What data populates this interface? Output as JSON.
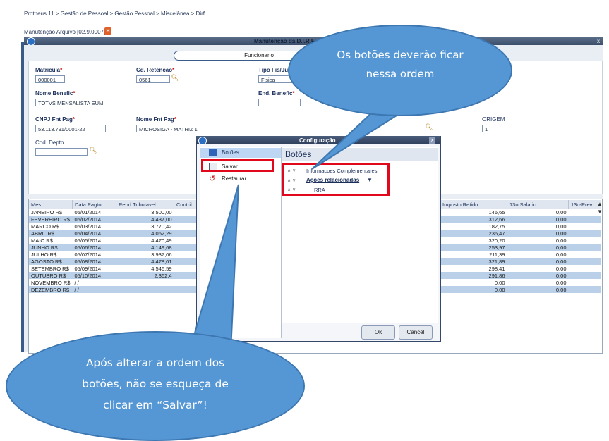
{
  "breadcrumb": "Protheus 11 > Gestão de Pessoal > Gestão Pessoal > Miscelânea > Dirf",
  "subtitle": "Manutenção Arquivo [02.9.0007]",
  "window": {
    "title": "Manutenção da D.I.R.F.",
    "close": "x"
  },
  "tab_label": "Funcionario",
  "form": {
    "matricula_label": "Matricula",
    "matricula_value": "000001",
    "cdret_label": "Cd. Retencao",
    "cdret_value": "0561",
    "tipo_label": "Tipo Fis/Jur",
    "tipo_value": "Fisica",
    "nome_label": "Nome Benefic",
    "nome_value": "TOTVS MENSALISTA EUM",
    "end_label": "End. Benefic",
    "cnpj_label": "CNPJ Fnt Pag",
    "cnpj_value": "53.113.791/0001-22",
    "nomefnt_label": "Nome Fnt Pag",
    "nomefnt_value": "MICROSIGA - MATRIZ 1",
    "origem_label": "ORIGEM",
    "origem_value": "1",
    "depto_label": "Cod. Depto.",
    "required_mark": "*"
  },
  "grid": {
    "headers": [
      "Mes",
      "Data Pagto",
      "Rend.Tributavel",
      "Contrib"
    ],
    "right_headers": [
      "Imposto Retido",
      "13o Salario",
      "13o-Prev."
    ],
    "rows": [
      {
        "mes": "JANEIRO   R$",
        "data": "05/01/2014",
        "rend": "3.500,00",
        "imp": "146,65",
        "sal": "0,00"
      },
      {
        "mes": "FEVEREIRO R$",
        "data": "05/02/2014",
        "rend": "4.437,00",
        "imp": "312,66",
        "sal": "0,00"
      },
      {
        "mes": "MARCO     R$",
        "data": "05/03/2014",
        "rend": "3.770,42",
        "imp": "182,75",
        "sal": "0,00"
      },
      {
        "mes": "ABRIL     R$",
        "data": "05/04/2014",
        "rend": "4.062,29",
        "imp": "236,47",
        "sal": "0,00"
      },
      {
        "mes": "MAIO      R$",
        "data": "05/05/2014",
        "rend": "4.470,49",
        "imp": "320,20",
        "sal": "0,00"
      },
      {
        "mes": "JUNHO     R$",
        "data": "05/06/2014",
        "rend": "4.149,68",
        "imp": "253,97",
        "sal": "0,00"
      },
      {
        "mes": "JULHO     R$",
        "data": "05/07/2014",
        "rend": "3.937,06",
        "imp": "211,39",
        "sal": "0,00"
      },
      {
        "mes": "AGOSTO    R$",
        "data": "05/08/2014",
        "rend": "4.478,01",
        "imp": "321,89",
        "sal": "0,00"
      },
      {
        "mes": "SETEMBRO  R$",
        "data": "05/09/2014",
        "rend": "4.546,59",
        "imp": "298,41",
        "sal": "0,00"
      },
      {
        "mes": "OUTUBRO   R$",
        "data": "05/10/2014",
        "rend": "2.362,4",
        "imp": "291,86",
        "sal": "0,00"
      },
      {
        "mes": "NOVEMBRO  R$",
        "data": "/ /",
        "rend": "",
        "imp": "0,00",
        "sal": "0,00"
      },
      {
        "mes": "DEZEMBRO  R$",
        "data": "/ /",
        "rend": "",
        "imp": "0,00",
        "sal": "0,00"
      }
    ]
  },
  "dialog": {
    "title": "Configuração",
    "close": "x",
    "menu": [
      "Botões",
      "Salvar",
      "Restaurar"
    ],
    "panel_title": "Botões",
    "items": [
      "Informacoes Complementares",
      "Ações relacionadas",
      "RRA"
    ],
    "ok": "Ok",
    "cancel": "Cancel"
  },
  "callouts": {
    "top": "Os botões deverão ficar nessa ordem",
    "bottom_line1": "Após alterar a ordem dos",
    "bottom_line2": "botões, não se esqueça de",
    "bottom_line3": "clicar em “Salvar”!"
  },
  "colors": {
    "highlight_border": "#e0081a",
    "bubble_fill": "#5597d4",
    "row_alt": "#b9d0e8"
  }
}
